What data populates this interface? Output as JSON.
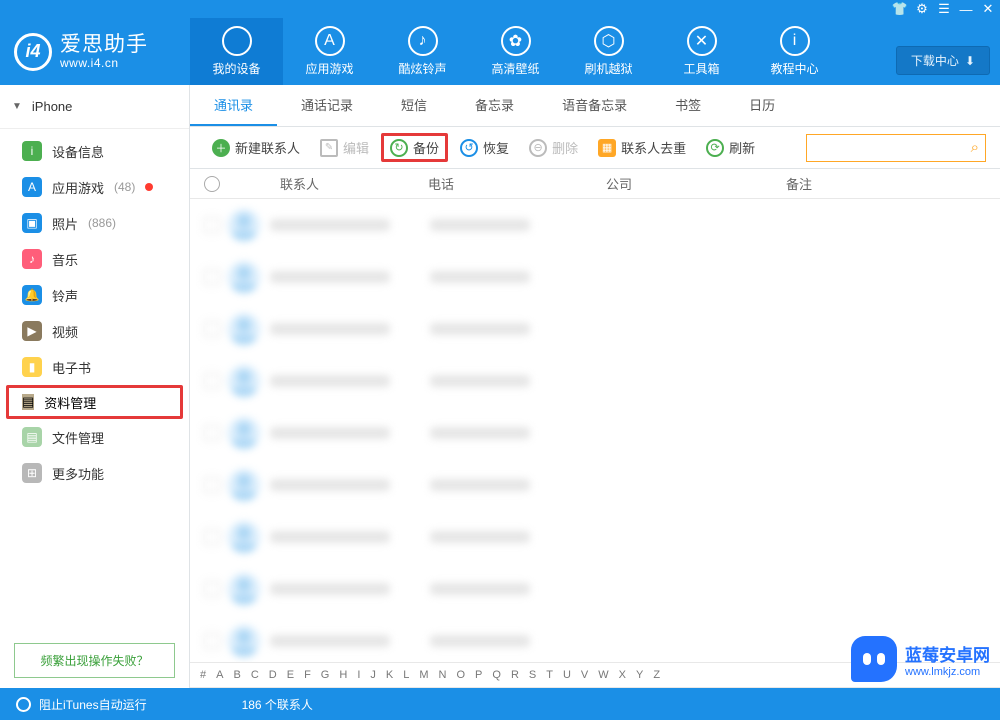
{
  "titlebar_icons": [
    "shirt",
    "gear",
    "menu",
    "minimize",
    "close"
  ],
  "brand": {
    "title": "爱思助手",
    "url": "www.i4.cn",
    "logo_text": "i4"
  },
  "nav": [
    {
      "label": "我的设备",
      "icon": "",
      "active": true
    },
    {
      "label": "应用游戏",
      "icon": "A"
    },
    {
      "label": "酷炫铃声",
      "icon": "♪"
    },
    {
      "label": "高清壁纸",
      "icon": "✿"
    },
    {
      "label": "刷机越狱",
      "icon": "⬡"
    },
    {
      "label": "工具箱",
      "icon": "✕"
    },
    {
      "label": "教程中心",
      "icon": "i"
    }
  ],
  "download_btn": "下载中心",
  "device_name": "iPhone",
  "sidebar": [
    {
      "label": "设备信息",
      "color": "#4caf50",
      "glyph": "i"
    },
    {
      "label": "应用游戏",
      "color": "#1b8fe6",
      "glyph": "A",
      "count": "(48)",
      "dot": true
    },
    {
      "label": "照片",
      "color": "#1b8fe6",
      "glyph": "▣",
      "count": "(886)"
    },
    {
      "label": "音乐",
      "color": "#ff5e7a",
      "glyph": "♪"
    },
    {
      "label": "铃声",
      "color": "#1b8fe6",
      "glyph": "🔔"
    },
    {
      "label": "视频",
      "color": "#8a7a5e",
      "glyph": "▶"
    },
    {
      "label": "电子书",
      "color": "#ffd24d",
      "glyph": "▮"
    },
    {
      "label": "资料管理",
      "color": "#b8a98a",
      "glyph": "▤",
      "highlight": true
    },
    {
      "label": "文件管理",
      "color": "#a8d4a8",
      "glyph": "▤"
    },
    {
      "label": "更多功能",
      "color": "#b8b8b8",
      "glyph": "⊞"
    }
  ],
  "fail_link": "频繁出现操作失败？",
  "tabs": [
    "通讯录",
    "通话记录",
    "短信",
    "备忘录",
    "语音备忘录",
    "书签",
    "日历"
  ],
  "active_tab": "通讯录",
  "toolbar": {
    "new_contact": "新建联系人",
    "edit": "编辑",
    "backup": "备份",
    "restore": "恢复",
    "delete": "删除",
    "dedup": "联系人去重",
    "refresh": "刷新"
  },
  "search_placeholder": "",
  "columns": {
    "contact": "联系人",
    "phone": "电话",
    "company": "公司",
    "note": "备注"
  },
  "row_count": 9,
  "alpha": [
    "#",
    "A",
    "B",
    "C",
    "D",
    "E",
    "F",
    "G",
    "H",
    "I",
    "J",
    "K",
    "L",
    "M",
    "N",
    "O",
    "P",
    "Q",
    "R",
    "S",
    "T",
    "U",
    "V",
    "W",
    "X",
    "Y",
    "Z"
  ],
  "status": {
    "left": "阻止iTunes自动运行",
    "center": "186 个联系人"
  },
  "watermark": {
    "title": "蓝莓安卓网",
    "url": "www.lmkjz.com"
  }
}
